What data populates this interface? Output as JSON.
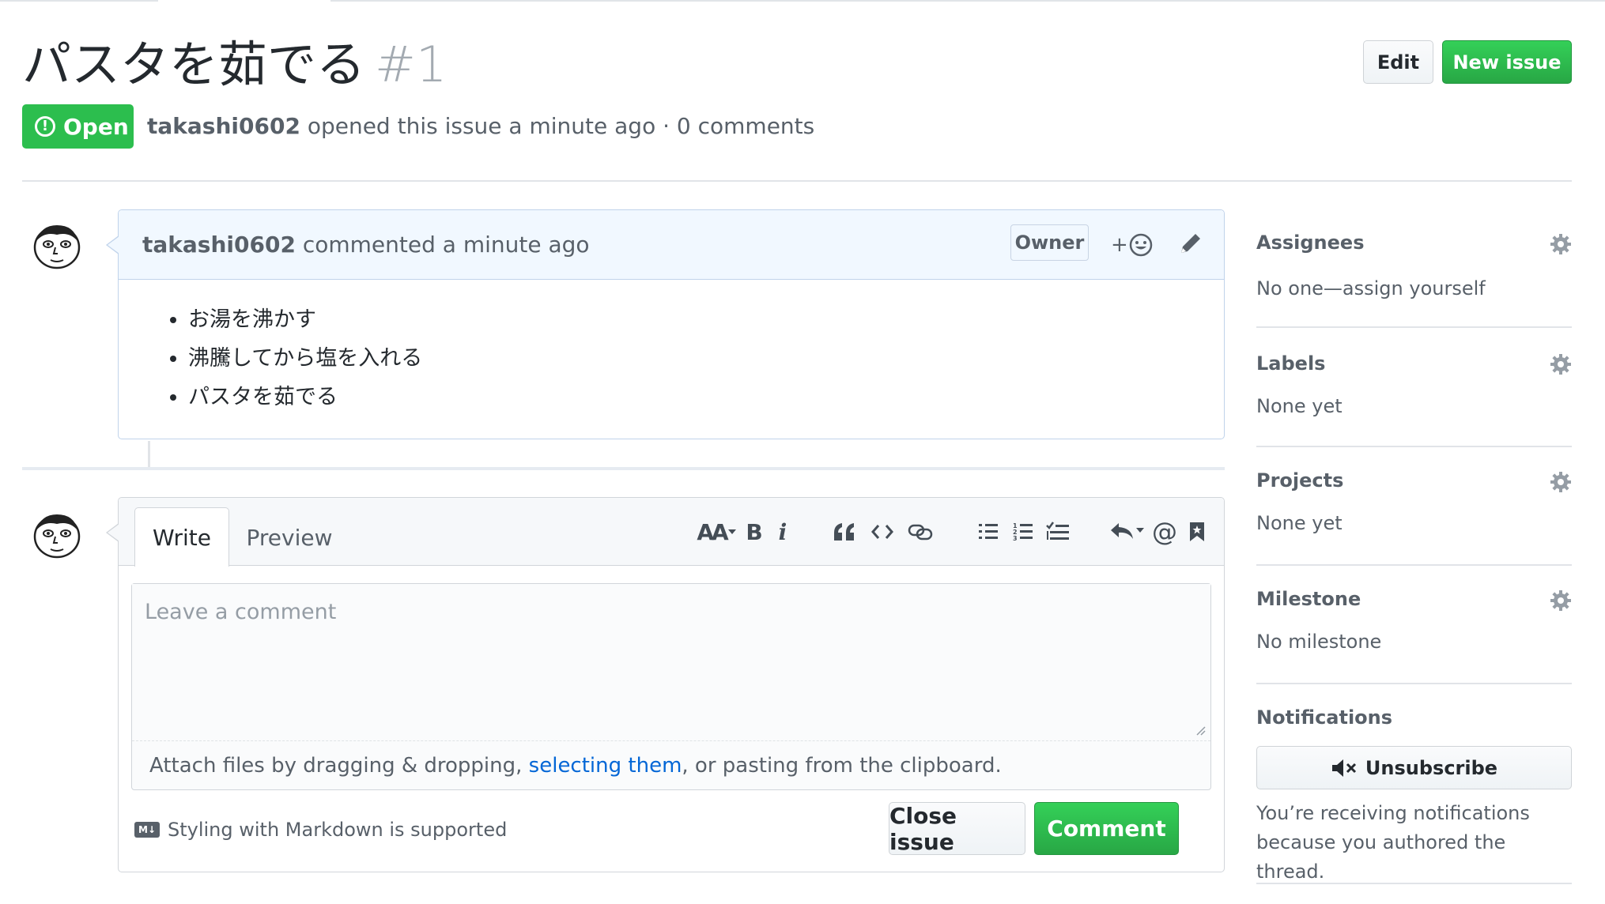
{
  "issue": {
    "title": "パスタを茹でる",
    "number": "#1",
    "state": "Open",
    "author": "takashi0602",
    "meta_text": "opened this issue a minute ago · 0 comments"
  },
  "header_buttons": {
    "edit_label": "Edit",
    "new_issue_label": "New issue"
  },
  "comment": {
    "author": "takashi0602",
    "action_text": "commented a minute ago",
    "owner_label": "Owner",
    "reaction_plus": "+",
    "body_items": [
      "お湯を沸かす",
      "沸騰してから塩を入れる",
      "パスタを茹でる"
    ]
  },
  "composer": {
    "tabs": {
      "write": "Write",
      "preview": "Preview"
    },
    "toolbar": {
      "heading": "AA",
      "bold": "B",
      "italic": "i",
      "mention": "@"
    },
    "placeholder": "Leave a comment",
    "attach_prefix": "Attach files by dragging & dropping, ",
    "attach_link": "selecting them",
    "attach_suffix": ", or pasting from the clipboard.",
    "markdown_note": "Styling with Markdown is supported",
    "markdown_icon": "M↓",
    "close_issue_label": "Close issue",
    "comment_label": "Comment"
  },
  "sidebar": {
    "assignees": {
      "heading": "Assignees",
      "value": "No one—assign yourself"
    },
    "labels": {
      "heading": "Labels",
      "value": "None yet"
    },
    "projects": {
      "heading": "Projects",
      "value": "None yet"
    },
    "milestone": {
      "heading": "Milestone",
      "value": "No milestone"
    },
    "notifications": {
      "heading": "Notifications",
      "button_label": "Unsubscribe",
      "reason_line1": "You’re receiving notifications",
      "reason_line2": "because you authored the thread."
    }
  },
  "colors": {
    "green": "#2cbe4e",
    "link": "#0366d6",
    "comment_header_bg": "#f1f8ff"
  },
  "icons": [
    "alert-icon",
    "smiley-icon",
    "pencil-icon",
    "gear-icon",
    "mute-icon",
    "markdown-icon",
    "quote-icon",
    "code-icon",
    "link-icon",
    "unordered-list-icon",
    "ordered-list-icon",
    "task-list-icon",
    "reply-icon",
    "bookmark-icon"
  ]
}
